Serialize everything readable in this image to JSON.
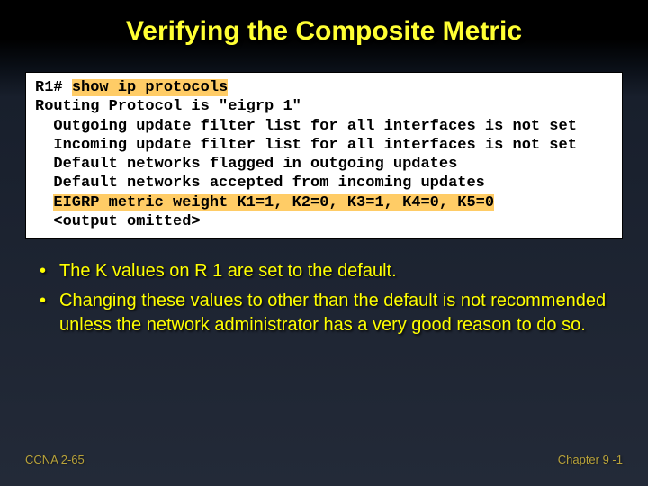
{
  "title": "Verifying the Composite Metric",
  "terminal": {
    "prompt": "R1# ",
    "command": "show ip protocols",
    "lines": [
      "Routing Protocol is \"eigrp 1\"",
      "  Outgoing update filter list for all interfaces is not set",
      "  Incoming update filter list for all interfaces is not set",
      "  Default networks flagged in outgoing updates",
      "  Default networks accepted from incoming updates"
    ],
    "metric_line_prefix": "  ",
    "metric_line": "EIGRP metric weight K1=1, K2=0, K3=1, K4=0, K5=0",
    "omitted": "  <output omitted>"
  },
  "bullets": [
    "The K values on R 1 are set to the default.",
    "Changing these values to other than the default is not recommended unless the network administrator has a very good reason to do so."
  ],
  "footer": {
    "left": "CCNA 2-65",
    "right": "Chapter  9 -1"
  }
}
